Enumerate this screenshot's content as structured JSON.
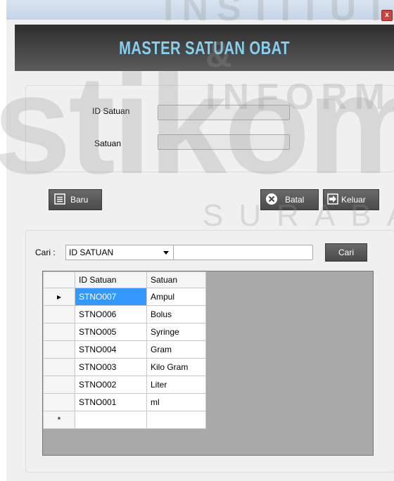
{
  "header": {
    "title": "MASTER SATUAN OBAT"
  },
  "window": {
    "close_glyph": "x"
  },
  "form": {
    "id_label": "ID Satuan",
    "id_value": "",
    "satuan_label": "Satuan",
    "satuan_value": ""
  },
  "buttons": {
    "baru": "Baru",
    "batal": "Batal",
    "keluar": "Keluar"
  },
  "search": {
    "label": "Cari :",
    "field_selected": "ID SATUAN",
    "value": "",
    "button": "Cari"
  },
  "grid": {
    "columns": [
      "ID Satuan",
      "Satuan"
    ],
    "rows": [
      {
        "id": "STNO007",
        "satuan": "Ampul"
      },
      {
        "id": "STNO006",
        "satuan": "Bolus"
      },
      {
        "id": "STNO005",
        "satuan": "Syringe"
      },
      {
        "id": "STNO004",
        "satuan": "Gram"
      },
      {
        "id": "STNO003",
        "satuan": "Kilo Gram"
      },
      {
        "id": "STNO002",
        "satuan": "Liter"
      },
      {
        "id": "STNO001",
        "satuan": "ml"
      }
    ],
    "current_row_marker": "▸",
    "new_row_marker": "*"
  },
  "watermark": {
    "line1": "INSTITUT",
    "line2": "& INFORMATIKA",
    "line3": "stikom",
    "line4": "SURABAYA"
  },
  "colors": {
    "header_title": "#86d0ee",
    "selected_cell": "#3399ff",
    "button_bg": "#555555"
  },
  "icons": {
    "baru": "document-icon",
    "batal": "cancel-circle-icon",
    "keluar": "exit-arrow-icon",
    "dropdown": "chevron-down-icon"
  }
}
